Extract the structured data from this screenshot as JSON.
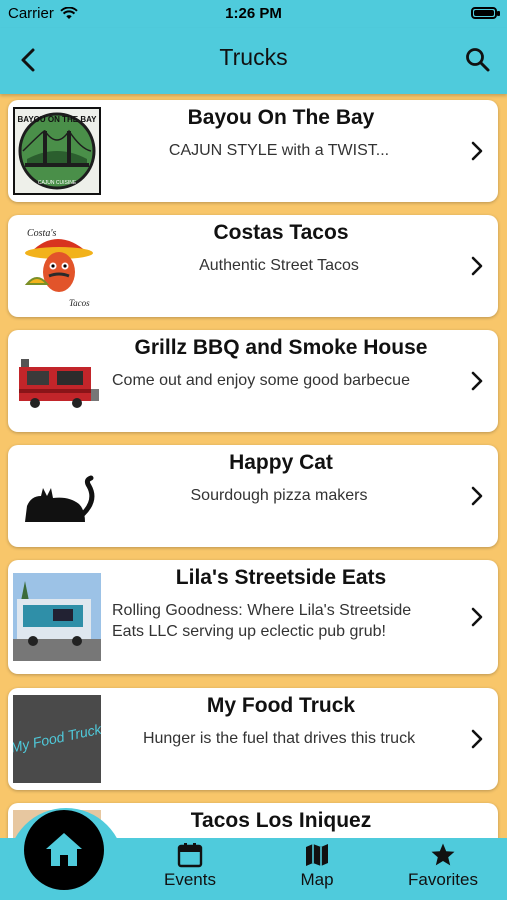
{
  "status": {
    "carrier": "Carrier",
    "time": "1:26 PM"
  },
  "nav": {
    "title": "Trucks",
    "back_icon": "chevron-left-icon",
    "search_icon": "search-icon"
  },
  "trucks": [
    {
      "name": "Bayou On The Bay",
      "description": "CAJUN STYLE with a TWIST...",
      "logo_text": "BAYOU ON THE BAY",
      "logo_subtext": "CAJUN CUISINE"
    },
    {
      "name": "Costas Tacos",
      "description": "Authentic Street Tacos",
      "logo_text": "Costa's",
      "logo_subtext": "Tacos"
    },
    {
      "name": "Grillz BBQ and Smoke House",
      "description": "Come out and enjoy some good barbecue"
    },
    {
      "name": "Happy Cat",
      "description": "Sourdough pizza makers"
    },
    {
      "name": "Lila's Streetside Eats",
      "description": "Rolling Goodness: Where Lila's Streetside Eats LLC serving up eclectic pub grub!"
    },
    {
      "name": "My Food Truck",
      "description": "Hunger is the fuel that drives this truck",
      "logo_text": "My Food Truck"
    },
    {
      "name": "Tacos Los Iniquez",
      "description": ""
    }
  ],
  "tabs": {
    "home_icon": "home-icon",
    "events_label": "Events",
    "map_label": "Map",
    "favorites_label": "Favorites"
  },
  "colors": {
    "primary": "#4fcbdc",
    "background": "#f8c66a",
    "card": "#ffffff"
  }
}
